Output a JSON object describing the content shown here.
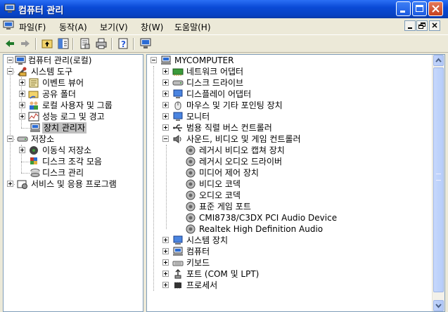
{
  "window": {
    "title": "컴퓨터 관리"
  },
  "menu": [
    "파일(F)",
    "동작(A)",
    "보기(V)",
    "창(W)",
    "도움말(H)"
  ],
  "toolbar": [
    "back-arrow-icon",
    "forward-arrow-icon",
    "up-folder-icon",
    "show-hide-tree-icon",
    "properties-icon",
    "print-icon",
    "help-icon",
    "scan-hardware-icon"
  ],
  "left_tree": {
    "root": "컴퓨터 관리(로컬)",
    "system_tools": "시스템 도구",
    "event_viewer": "이벤트 뷰어",
    "shared_folders": "공유 폴더",
    "local_users": "로컬 사용자 및 그룹",
    "perf_logs": "성능 로그 및 경고",
    "device_manager": "장치 관리자",
    "storage": "저장소",
    "removable_storage": "이동식 저장소",
    "defrag": "디스크 조각 모음",
    "disk_mgmt": "디스크 관리",
    "services_apps": "서비스 및 응용 프로그램"
  },
  "right_tree": {
    "computer": "MYCOMPUTER",
    "categories": [
      {
        "label": "네트워크 어댑터",
        "icon": "network-adapter-icon",
        "expanded": false
      },
      {
        "label": "디스크 드라이브",
        "icon": "disk-drive-icon",
        "expanded": false
      },
      {
        "label": "디스플레이 어댑터",
        "icon": "display-adapter-icon",
        "expanded": false
      },
      {
        "label": "마우스 및 기타 포인팅 장치",
        "icon": "mouse-icon",
        "expanded": false
      },
      {
        "label": "모니터",
        "icon": "monitor-icon",
        "expanded": false
      },
      {
        "label": "범용 직렬 버스 컨트롤러",
        "icon": "usb-icon",
        "expanded": false
      },
      {
        "label": "사운드, 비디오 및 게임 컨트롤러",
        "icon": "sound-icon",
        "expanded": true
      }
    ],
    "sound_children": [
      "레거시 비디오 캡쳐 장치",
      "레거시 오디오 드라이버",
      "미디어 제어 장치",
      "비디오 코덱",
      "오디오 코덱",
      "표준 게임 포트",
      "CMI8738/C3DX PCI Audio Device",
      "Realtek High Definition Audio"
    ],
    "categories_after": [
      {
        "label": "시스템 장치",
        "icon": "system-device-icon"
      },
      {
        "label": "컴퓨터",
        "icon": "computer-icon"
      },
      {
        "label": "키보드",
        "icon": "keyboard-icon"
      },
      {
        "label": "포트 (COM 및 LPT)",
        "icon": "port-icon"
      },
      {
        "label": "프로세서",
        "icon": "processor-icon"
      }
    ]
  },
  "colors": {
    "title_blue": "#0a4ad6",
    "selection": "#c0c0c0",
    "pane_border": "#7f9db9"
  }
}
